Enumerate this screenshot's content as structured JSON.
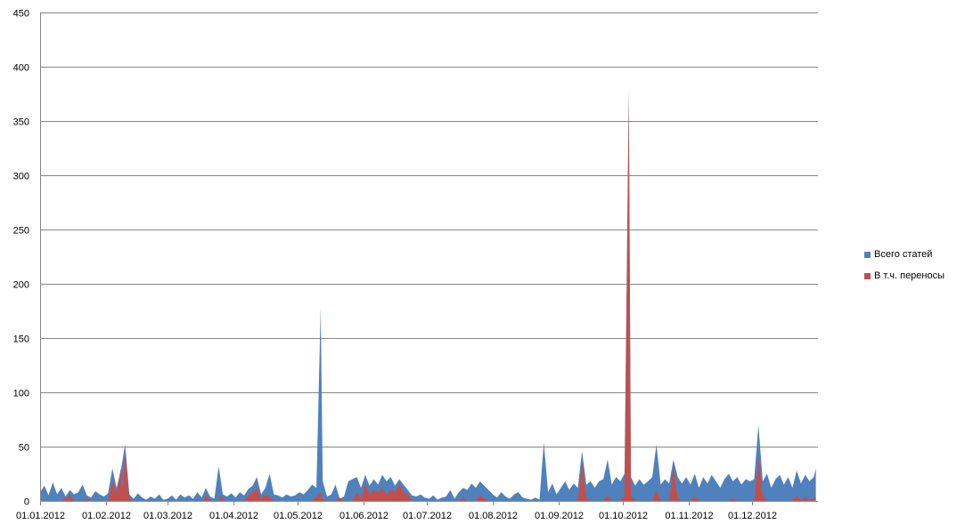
{
  "chart_data": {
    "type": "area",
    "start_date": "01.01.2012",
    "x_tick_labels": [
      "01.01.2012",
      "01.02.2012",
      "01.03.2012",
      "01.04.2012",
      "01.05.2012",
      "01.06.2012",
      "01.07.2012",
      "01.08.2012",
      "01.09.2012",
      "01.10.2012",
      "01.11.2012",
      "01.12.2012"
    ],
    "y_ticks": [
      0,
      50,
      100,
      150,
      200,
      250,
      300,
      350,
      400,
      450
    ],
    "ylim": [
      0,
      450
    ],
    "grid": true,
    "legend_position": "right",
    "series": [
      {
        "name": "Всего статей",
        "color": "#4F81BD",
        "points": [
          [
            "01.01.2012",
            8
          ],
          [
            "03.01.2012",
            14
          ],
          [
            "05.01.2012",
            5
          ],
          [
            "07.01.2012",
            17
          ],
          [
            "09.01.2012",
            6
          ],
          [
            "11.01.2012",
            12
          ],
          [
            "13.01.2012",
            4
          ],
          [
            "15.01.2012",
            10
          ],
          [
            "17.01.2012",
            6
          ],
          [
            "19.01.2012",
            8
          ],
          [
            "21.01.2012",
            15
          ],
          [
            "23.01.2012",
            5
          ],
          [
            "25.01.2012",
            3
          ],
          [
            "27.01.2012",
            9
          ],
          [
            "29.01.2012",
            6
          ],
          [
            "31.01.2012",
            4
          ],
          [
            "02.02.2012",
            7
          ],
          [
            "04.02.2012",
            30
          ],
          [
            "06.02.2012",
            12
          ],
          [
            "08.02.2012",
            28
          ],
          [
            "10.02.2012",
            52
          ],
          [
            "12.02.2012",
            6
          ],
          [
            "14.02.2012",
            2
          ],
          [
            "16.02.2012",
            7
          ],
          [
            "18.02.2012",
            3
          ],
          [
            "20.02.2012",
            1
          ],
          [
            "22.02.2012",
            4
          ],
          [
            "24.02.2012",
            2
          ],
          [
            "26.02.2012",
            6
          ],
          [
            "28.02.2012",
            1
          ],
          [
            "01.03.2012",
            2
          ],
          [
            "03.03.2012",
            5
          ],
          [
            "05.03.2012",
            1
          ],
          [
            "07.03.2012",
            6
          ],
          [
            "09.03.2012",
            3
          ],
          [
            "11.03.2012",
            5
          ],
          [
            "13.03.2012",
            2
          ],
          [
            "15.03.2012",
            8
          ],
          [
            "17.03.2012",
            3
          ],
          [
            "19.03.2012",
            12
          ],
          [
            "21.03.2012",
            4
          ],
          [
            "23.03.2012",
            2
          ],
          [
            "25.03.2012",
            32
          ],
          [
            "27.03.2012",
            6
          ],
          [
            "29.03.2012",
            4
          ],
          [
            "31.03.2012",
            7
          ],
          [
            "02.04.2012",
            3
          ],
          [
            "04.04.2012",
            8
          ],
          [
            "06.04.2012",
            5
          ],
          [
            "08.04.2012",
            11
          ],
          [
            "10.04.2012",
            14
          ],
          [
            "12.04.2012",
            22
          ],
          [
            "14.04.2012",
            6
          ],
          [
            "16.04.2012",
            12
          ],
          [
            "18.04.2012",
            25
          ],
          [
            "20.04.2012",
            6
          ],
          [
            "22.04.2012",
            5
          ],
          [
            "24.04.2012",
            3
          ],
          [
            "26.04.2012",
            6
          ],
          [
            "28.04.2012",
            4
          ],
          [
            "30.04.2012",
            5
          ],
          [
            "02.05.2012",
            8
          ],
          [
            "04.05.2012",
            6
          ],
          [
            "06.05.2012",
            10
          ],
          [
            "08.05.2012",
            15
          ],
          [
            "10.05.2012",
            12
          ],
          [
            "12.05.2012",
            178
          ],
          [
            "13.05.2012",
            18
          ],
          [
            "15.05.2012",
            4
          ],
          [
            "17.05.2012",
            6
          ],
          [
            "19.05.2012",
            15
          ],
          [
            "21.05.2012",
            2
          ],
          [
            "23.05.2012",
            4
          ],
          [
            "25.05.2012",
            18
          ],
          [
            "27.05.2012",
            20
          ],
          [
            "29.05.2012",
            22
          ],
          [
            "31.05.2012",
            12
          ],
          [
            "02.06.2012",
            24
          ],
          [
            "04.06.2012",
            14
          ],
          [
            "06.06.2012",
            20
          ],
          [
            "08.06.2012",
            15
          ],
          [
            "10.06.2012",
            24
          ],
          [
            "12.06.2012",
            18
          ],
          [
            "14.06.2012",
            22
          ],
          [
            "16.06.2012",
            14
          ],
          [
            "18.06.2012",
            20
          ],
          [
            "20.06.2012",
            15
          ],
          [
            "22.06.2012",
            10
          ],
          [
            "24.06.2012",
            5
          ],
          [
            "26.06.2012",
            4
          ],
          [
            "28.06.2012",
            6
          ],
          [
            "30.06.2012",
            3
          ],
          [
            "02.07.2012",
            2
          ],
          [
            "04.07.2012",
            5
          ],
          [
            "06.07.2012",
            1
          ],
          [
            "08.07.2012",
            3
          ],
          [
            "10.07.2012",
            4
          ],
          [
            "12.07.2012",
            10
          ],
          [
            "14.07.2012",
            2
          ],
          [
            "16.07.2012",
            8
          ],
          [
            "18.07.2012",
            12
          ],
          [
            "20.07.2012",
            10
          ],
          [
            "22.07.2012",
            16
          ],
          [
            "24.07.2012",
            12
          ],
          [
            "26.07.2012",
            18
          ],
          [
            "28.07.2012",
            14
          ],
          [
            "30.07.2012",
            10
          ],
          [
            "01.08.2012",
            6
          ],
          [
            "03.08.2012",
            3
          ],
          [
            "05.08.2012",
            8
          ],
          [
            "07.08.2012",
            4
          ],
          [
            "09.08.2012",
            2
          ],
          [
            "11.08.2012",
            6
          ],
          [
            "13.08.2012",
            8
          ],
          [
            "15.08.2012",
            3
          ],
          [
            "17.08.2012",
            2
          ],
          [
            "19.08.2012",
            1
          ],
          [
            "21.08.2012",
            3
          ],
          [
            "23.08.2012",
            1
          ],
          [
            "25.08.2012",
            54
          ],
          [
            "27.08.2012",
            8
          ],
          [
            "29.08.2012",
            16
          ],
          [
            "31.08.2012",
            6
          ],
          [
            "02.09.2012",
            12
          ],
          [
            "04.09.2012",
            18
          ],
          [
            "06.09.2012",
            10
          ],
          [
            "08.09.2012",
            16
          ],
          [
            "10.09.2012",
            12
          ],
          [
            "12.09.2012",
            46
          ],
          [
            "14.09.2012",
            15
          ],
          [
            "16.09.2012",
            18
          ],
          [
            "18.09.2012",
            12
          ],
          [
            "20.09.2012",
            18
          ],
          [
            "22.09.2012",
            20
          ],
          [
            "24.09.2012",
            38
          ],
          [
            "26.09.2012",
            15
          ],
          [
            "28.09.2012",
            22
          ],
          [
            "30.09.2012",
            18
          ],
          [
            "02.10.2012",
            25
          ],
          [
            "04.10.2012",
            380
          ],
          [
            "05.10.2012",
            22
          ],
          [
            "07.10.2012",
            14
          ],
          [
            "09.10.2012",
            20
          ],
          [
            "11.10.2012",
            15
          ],
          [
            "13.10.2012",
            18
          ],
          [
            "15.10.2012",
            22
          ],
          [
            "17.10.2012",
            52
          ],
          [
            "19.10.2012",
            15
          ],
          [
            "21.10.2012",
            20
          ],
          [
            "23.10.2012",
            16
          ],
          [
            "25.10.2012",
            38
          ],
          [
            "27.10.2012",
            22
          ],
          [
            "29.10.2012",
            16
          ],
          [
            "31.10.2012",
            22
          ],
          [
            "02.11.2012",
            15
          ],
          [
            "04.11.2012",
            25
          ],
          [
            "06.11.2012",
            12
          ],
          [
            "08.11.2012",
            22
          ],
          [
            "10.11.2012",
            16
          ],
          [
            "12.11.2012",
            24
          ],
          [
            "14.11.2012",
            18
          ],
          [
            "16.11.2012",
            12
          ],
          [
            "18.11.2012",
            20
          ],
          [
            "20.11.2012",
            25
          ],
          [
            "22.11.2012",
            18
          ],
          [
            "24.11.2012",
            22
          ],
          [
            "26.11.2012",
            15
          ],
          [
            "28.11.2012",
            20
          ],
          [
            "30.11.2012",
            18
          ],
          [
            "02.12.2012",
            20
          ],
          [
            "04.12.2012",
            70
          ],
          [
            "06.12.2012",
            18
          ],
          [
            "08.12.2012",
            25
          ],
          [
            "10.12.2012",
            12
          ],
          [
            "12.12.2012",
            20
          ],
          [
            "14.12.2012",
            24
          ],
          [
            "16.12.2012",
            15
          ],
          [
            "18.12.2012",
            22
          ],
          [
            "20.12.2012",
            12
          ],
          [
            "22.12.2012",
            28
          ],
          [
            "24.12.2012",
            16
          ],
          [
            "26.12.2012",
            24
          ],
          [
            "28.12.2012",
            18
          ],
          [
            "30.12.2012",
            22
          ],
          [
            "31.12.2012",
            30
          ]
        ]
      },
      {
        "name": "В т.ч. переносы",
        "color": "#C0504D",
        "points": [
          [
            "01.01.2012",
            0
          ],
          [
            "11.01.2012",
            0
          ],
          [
            "15.01.2012",
            5
          ],
          [
            "17.01.2012",
            0
          ],
          [
            "21.01.2012",
            0
          ],
          [
            "23.01.2012",
            2
          ],
          [
            "25.01.2012",
            0
          ],
          [
            "02.02.2012",
            0
          ],
          [
            "04.02.2012",
            18
          ],
          [
            "06.02.2012",
            8
          ],
          [
            "08.02.2012",
            30
          ],
          [
            "09.02.2012",
            10
          ],
          [
            "10.02.2012",
            48
          ],
          [
            "12.02.2012",
            2
          ],
          [
            "14.02.2012",
            0
          ],
          [
            "18.03.2012",
            0
          ],
          [
            "19.03.2012",
            6
          ],
          [
            "21.03.2012",
            0
          ],
          [
            "25.03.2012",
            0
          ],
          [
            "26.03.2012",
            5
          ],
          [
            "28.03.2012",
            0
          ],
          [
            "06.04.2012",
            0
          ],
          [
            "08.04.2012",
            5
          ],
          [
            "10.04.2012",
            8
          ],
          [
            "12.04.2012",
            12
          ],
          [
            "14.04.2012",
            2
          ],
          [
            "16.04.2012",
            6
          ],
          [
            "18.04.2012",
            4
          ],
          [
            "20.04.2012",
            0
          ],
          [
            "08.05.2012",
            0
          ],
          [
            "10.05.2012",
            4
          ],
          [
            "12.05.2012",
            8
          ],
          [
            "13.05.2012",
            2
          ],
          [
            "15.05.2012",
            0
          ],
          [
            "19.05.2012",
            0
          ],
          [
            "21.05.2012",
            3
          ],
          [
            "23.05.2012",
            0
          ],
          [
            "27.05.2012",
            0
          ],
          [
            "29.05.2012",
            8
          ],
          [
            "31.05.2012",
            2
          ],
          [
            "02.06.2012",
            16
          ],
          [
            "04.06.2012",
            6
          ],
          [
            "06.06.2012",
            10
          ],
          [
            "08.06.2012",
            8
          ],
          [
            "10.06.2012",
            12
          ],
          [
            "12.06.2012",
            6
          ],
          [
            "14.06.2012",
            10
          ],
          [
            "16.06.2012",
            8
          ],
          [
            "18.06.2012",
            16
          ],
          [
            "20.06.2012",
            8
          ],
          [
            "22.06.2012",
            6
          ],
          [
            "24.06.2012",
            0
          ],
          [
            "16.07.2012",
            0
          ],
          [
            "18.07.2012",
            3
          ],
          [
            "20.07.2012",
            0
          ],
          [
            "24.07.2012",
            0
          ],
          [
            "26.07.2012",
            6
          ],
          [
            "28.07.2012",
            2
          ],
          [
            "30.07.2012",
            0
          ],
          [
            "10.09.2012",
            0
          ],
          [
            "12.09.2012",
            35
          ],
          [
            "14.09.2012",
            2
          ],
          [
            "16.09.2012",
            0
          ],
          [
            "22.09.2012",
            0
          ],
          [
            "24.09.2012",
            5
          ],
          [
            "26.09.2012",
            0
          ],
          [
            "30.09.2012",
            0
          ],
          [
            "02.10.2012",
            5
          ],
          [
            "04.10.2012",
            370
          ],
          [
            "05.10.2012",
            5
          ],
          [
            "07.10.2012",
            0
          ],
          [
            "15.10.2012",
            0
          ],
          [
            "17.10.2012",
            10
          ],
          [
            "19.10.2012",
            0
          ],
          [
            "23.10.2012",
            0
          ],
          [
            "25.10.2012",
            32
          ],
          [
            "27.10.2012",
            2
          ],
          [
            "29.10.2012",
            0
          ],
          [
            "02.11.2012",
            0
          ],
          [
            "04.11.2012",
            4
          ],
          [
            "06.11.2012",
            0
          ],
          [
            "20.11.2012",
            0
          ],
          [
            "22.11.2012",
            2
          ],
          [
            "24.11.2012",
            0
          ],
          [
            "02.12.2012",
            0
          ],
          [
            "04.12.2012",
            40
          ],
          [
            "06.12.2012",
            4
          ],
          [
            "08.12.2012",
            0
          ],
          [
            "20.12.2012",
            0
          ],
          [
            "22.12.2012",
            5
          ],
          [
            "24.12.2012",
            0
          ],
          [
            "26.12.2012",
            4
          ],
          [
            "28.12.2012",
            0
          ],
          [
            "31.12.2012",
            3
          ]
        ]
      }
    ]
  }
}
